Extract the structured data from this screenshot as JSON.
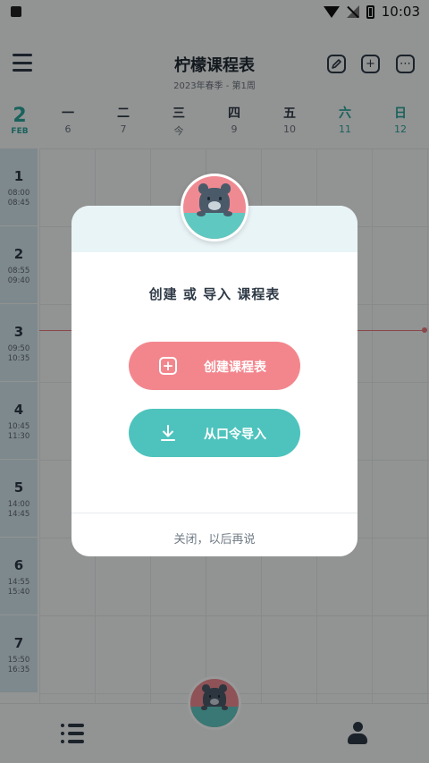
{
  "status_bar": {
    "time": "10:03"
  },
  "header": {
    "title": "柠檬课程表",
    "subtitle": "2023年春季 - 第1周"
  },
  "week": {
    "month_number": "2",
    "month_label": "FEB",
    "days": [
      {
        "name": "一",
        "date": "6"
      },
      {
        "name": "二",
        "date": "7"
      },
      {
        "name": "三",
        "date": "今"
      },
      {
        "name": "四",
        "date": "9"
      },
      {
        "name": "五",
        "date": "10"
      },
      {
        "name": "六",
        "date": "11"
      },
      {
        "name": "日",
        "date": "12"
      }
    ]
  },
  "periods": [
    {
      "num": "1",
      "start": "08:00",
      "end": "08:45"
    },
    {
      "num": "2",
      "start": "08:55",
      "end": "09:40"
    },
    {
      "num": "3",
      "start": "09:50",
      "end": "10:35"
    },
    {
      "num": "4",
      "start": "10:45",
      "end": "11:30"
    },
    {
      "num": "5",
      "start": "14:00",
      "end": "14:45"
    },
    {
      "num": "6",
      "start": "14:55",
      "end": "15:40"
    },
    {
      "num": "7",
      "start": "15:50",
      "end": "16:35"
    }
  ],
  "dialog": {
    "title": "创建 或 导入 课程表",
    "create_label": "创建课程表",
    "import_label": "从口令导入",
    "close_label": "关闭，以后再说"
  },
  "icons": {
    "menu": "menu-icon",
    "edit": "edit-icon",
    "add": "add-icon",
    "more": "more-icon",
    "list": "list-icon",
    "user": "user-icon",
    "download": "download-icon",
    "mascot": "bear-mascot"
  },
  "colors": {
    "accent_teal": "#4ec3bd",
    "accent_pink": "#f3868d",
    "now_line": "#e6777c",
    "period_bg": "#d3e5ec"
  }
}
